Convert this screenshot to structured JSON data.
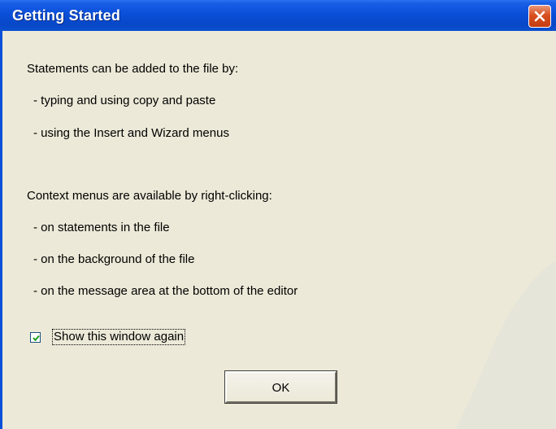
{
  "window": {
    "title": "Getting Started",
    "close_icon": "close-icon"
  },
  "colors": {
    "titlebar": "#0a4fd8",
    "close_button": "#d9501f",
    "dialog_background": "#ece9d8"
  },
  "message": {
    "statements_heading": "Statements can be added to the file by:",
    "statements_items": [
      "- typing and using copy and paste",
      "- using the Insert and Wizard menus"
    ],
    "context_heading": "Context menus are available by right-clicking:",
    "context_items": [
      "- on statements in the file",
      "- on the background of the file",
      "- on the message area at the bottom of the editor"
    ]
  },
  "options": {
    "show_again_label": "Show this window again",
    "show_again_checked": true
  },
  "buttons": {
    "ok_label": "OK"
  }
}
